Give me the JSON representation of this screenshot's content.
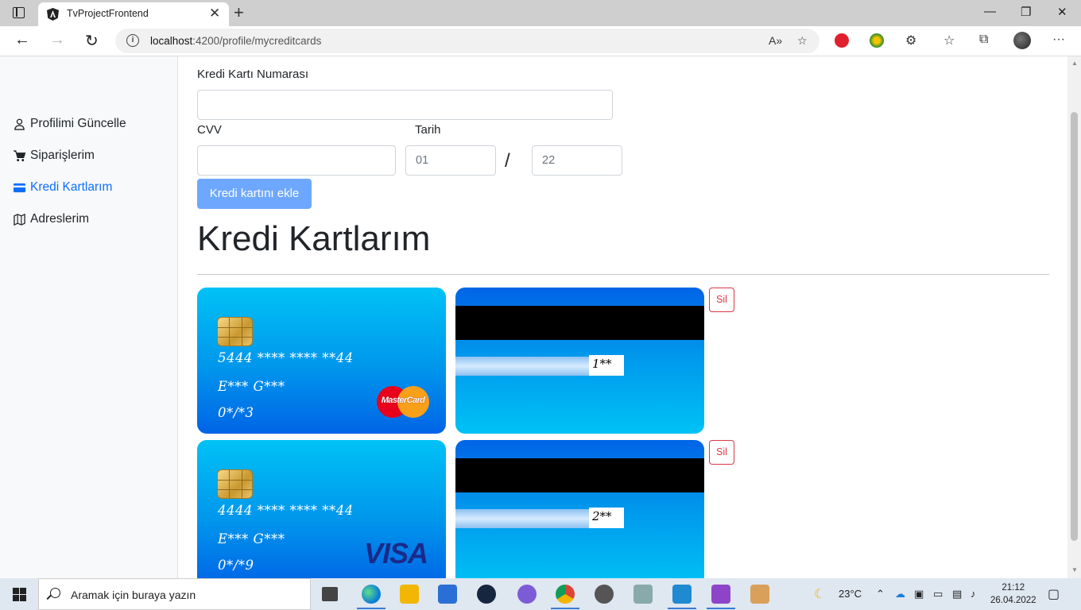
{
  "browser": {
    "tab_title": "TvProjectFrontend",
    "url_host": "localhost",
    "url_path": ":4200/profile/mycreditcards"
  },
  "sidebar": {
    "items": [
      {
        "label": "Profilimi Güncelle",
        "icon": "user-icon",
        "active": false
      },
      {
        "label": "Siparişlerim",
        "icon": "cart-icon",
        "active": false
      },
      {
        "label": "Kredi Kartlarım",
        "icon": "credit-card-icon",
        "active": true
      },
      {
        "label": "Adreslerim",
        "icon": "map-icon",
        "active": false
      }
    ]
  },
  "form": {
    "card_number_label": "Kredi Kartı Numarası",
    "card_number_value": "",
    "cvv_label": "CVV",
    "cvv_value": "",
    "date_label": "Tarih",
    "month_value": "01",
    "year_value": "22",
    "separator": "/",
    "submit_label": "Kredi kartını ekle"
  },
  "heading": "Kredi Kartlarım",
  "cards": [
    {
      "number": "5444 **** **** **44",
      "holder": "E*** G***",
      "expiry": "0*/*3",
      "brand": "MasterCard",
      "cvv": "1**",
      "delete_label": "Sil"
    },
    {
      "number": "4444 **** **** **44",
      "holder": "E*** G***",
      "expiry": "0*/*9",
      "brand": "VISA",
      "cvv": "2**",
      "delete_label": "Sil"
    }
  ],
  "taskbar": {
    "search_placeholder": "Aramak için buraya yazın",
    "temperature": "23°C",
    "time": "21:12",
    "date": "26.04.2022"
  },
  "colors": {
    "accent": "#0d6efd",
    "button": "#6ea8fe",
    "danger": "#dc3545"
  }
}
